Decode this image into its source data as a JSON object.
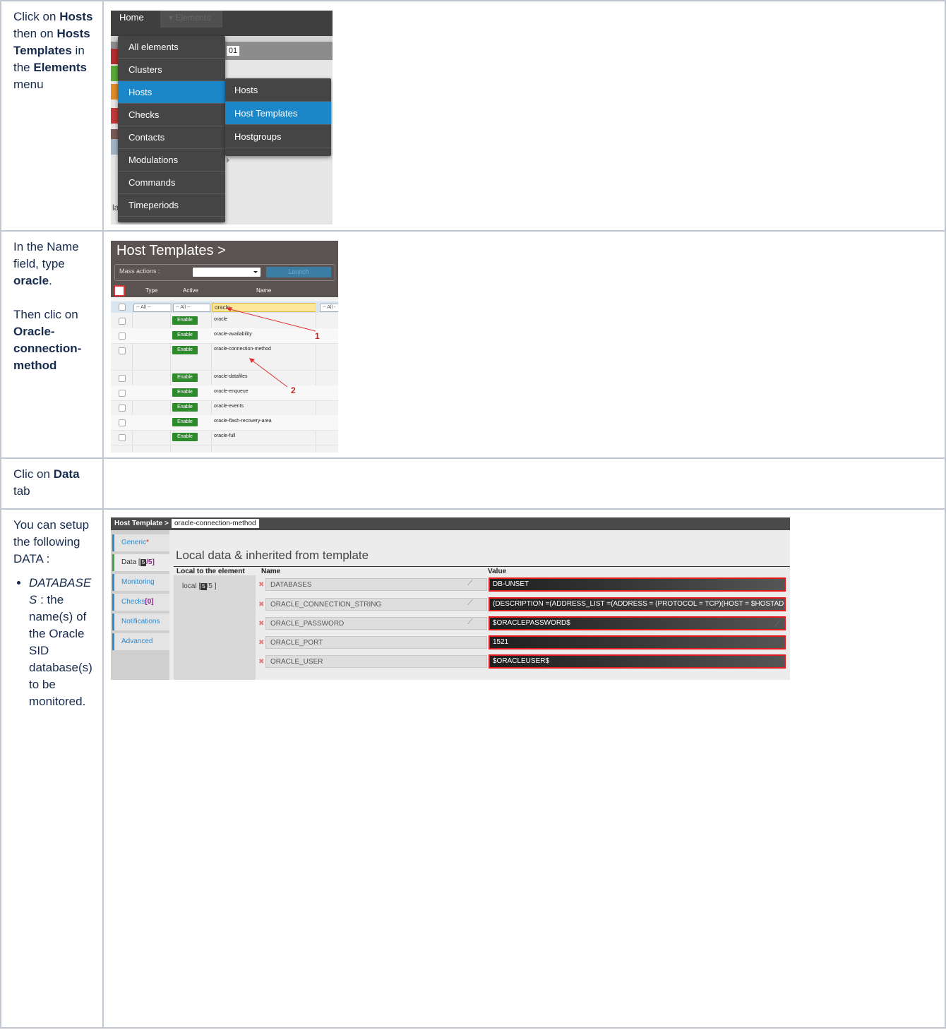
{
  "rows": [
    {
      "instruction_parts": [
        {
          "t": "Click on ",
          "b": false
        },
        {
          "t": "Hosts",
          "b": true
        },
        {
          "t": " then on ",
          "b": false
        },
        {
          "t": "Hosts Templates",
          "b": true
        },
        {
          "t": " in the ",
          "b": false
        },
        {
          "t": "Elements",
          "b": true
        },
        {
          "t": " menu",
          "b": false
        }
      ]
    },
    {
      "p1": [
        {
          "t": "In the Name field, type ",
          "b": false
        },
        {
          "t": "oracle",
          "b": true
        },
        {
          "t": ".",
          "b": false
        }
      ],
      "p2": [
        {
          "t": "Then clic on ",
          "b": false
        },
        {
          "t": "Oracle-connection-method",
          "b": true
        }
      ]
    },
    {
      "instruction_parts": [
        {
          "t": "Clic on ",
          "b": false
        },
        {
          "t": "Data",
          "b": true
        },
        {
          "t": " tab",
          "b": false
        }
      ]
    },
    {
      "intro": "You can setup the following DATA :",
      "bullets": [
        {
          "term": "DATABASES",
          "desc": " : the name(s) of the Oracle SID database(s) to be monitored."
        }
      ]
    }
  ],
  "menu_shot": {
    "home": "Home",
    "elements": "▾ Elements",
    "partial_text": "01",
    "partial_label": "la",
    "items": [
      "All elements",
      "Clusters",
      "Hosts",
      "Checks",
      "Contacts",
      "Modulations",
      "Commands",
      "Timeperiods"
    ],
    "active_item": "Hosts",
    "submenu": [
      "Hosts",
      "Host Templates",
      "Hostgroups"
    ],
    "active_sub": "Host Templates"
  },
  "list_shot": {
    "title": "Host Templates >",
    "mass_actions": "Mass actions :",
    "launch": "Launch",
    "col_type": "Type",
    "col_active": "Active",
    "col_name": "Name",
    "filter_all": "-- All --",
    "filter_all_short": "-- All -",
    "search_value": "oracle",
    "enable_label": "Enable",
    "names": [
      "oracle",
      "oracle-availability",
      "oracle-connection-method",
      "oracle-datafiles",
      "oracle-enqueue",
      "oracle-events",
      "oracle-flash-recovery-area",
      "oracle-full"
    ],
    "annotation_1": "1",
    "annotation_2": "2",
    "arrow_color": "#e03030"
  },
  "data_shot": {
    "breadcrumb": "Host Template >",
    "element_name": "oracle-connection-method",
    "tabs": [
      {
        "label": "Generic",
        "suffix": "*"
      },
      {
        "label": "Data [",
        "count": "5",
        "total": "/5]"
      },
      {
        "label": "Monitoring"
      },
      {
        "label": "Checks",
        "count": "[0]"
      },
      {
        "label": "Notifications"
      },
      {
        "label": "Advanced"
      }
    ],
    "heading": "Local data & inherited from template",
    "col_local": "Local to the element",
    "col_name": "Name",
    "col_value": "Value",
    "local_label": "local [",
    "local_count": "5",
    "local_total": "/5 ]",
    "properties": [
      {
        "name": "DATABASES",
        "value": "DB-UNSET"
      },
      {
        "name": "ORACLE_CONNECTION_STRING",
        "value": "(DESCRIPTION =(ADDRESS_LIST =(ADDRESS = (PROTOCOL = TCP)(HOST = $HOSTADDRESS$)"
      },
      {
        "name": "ORACLE_PASSWORD",
        "value": "$ORACLEPASSWORD$"
      },
      {
        "name": "ORACLE_PORT",
        "value": "1521"
      },
      {
        "name": "ORACLE_USER",
        "value": "$ORACLEUSER$"
      }
    ],
    "highlight_color": "#e31b1b"
  }
}
